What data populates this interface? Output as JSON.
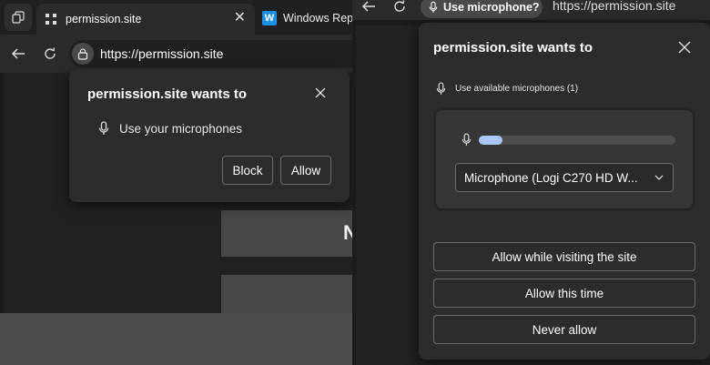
{
  "left_window": {
    "tabs": [
      {
        "title": "permission.site",
        "favicon": "dots-favicon",
        "active": true
      },
      {
        "title": "Windows Repo",
        "favicon": "w-favicon",
        "favicon_letter": "W",
        "active": false
      }
    ],
    "address_bar": {
      "url": "https://permission.site",
      "icon": "lock-icon"
    },
    "page_text": "N",
    "prompt": {
      "title": "permission.site wants to",
      "permission_text": "Use your microphones",
      "block_label": "Block",
      "allow_label": "Allow"
    }
  },
  "right_window": {
    "address_bar": {
      "chip_label": "Use microphone?",
      "url": "https://permission.site"
    },
    "prompt": {
      "title": "permission.site wants to",
      "subheading": "Use available microphones (1)",
      "mic_level_fraction": 0.12,
      "selected_device": "Microphone (Logi C270 HD W...",
      "buttons": {
        "allow_while_visiting": "Allow while visiting the site",
        "allow_this_time": "Allow this time",
        "never_allow": "Never allow"
      }
    }
  },
  "colors": {
    "background": "#1c1c1c",
    "popup": "#2c2c2c",
    "button_border": "#6a6a6a",
    "level_fill": "#a8c8f8"
  }
}
